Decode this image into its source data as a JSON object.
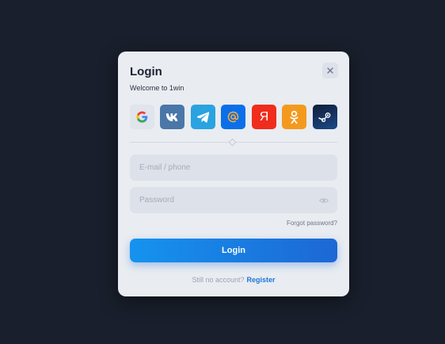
{
  "modal": {
    "title": "Login",
    "subtitle": "Welcome to 1win"
  },
  "social_buttons": [
    {
      "name": "google",
      "icon": "google-icon",
      "bg": "#e0e4ec"
    },
    {
      "name": "vk",
      "icon": "vk-icon",
      "bg": "#4a76a8"
    },
    {
      "name": "telegram",
      "icon": "telegram-icon",
      "bg": "#2aa3e0"
    },
    {
      "name": "mail",
      "icon": "at-icon",
      "bg": "#0b6fe9"
    },
    {
      "name": "yandex",
      "icon": "yandex-icon",
      "bg": "#f02c1c",
      "glyph": "Я"
    },
    {
      "name": "odnoklassniki",
      "icon": "ok-icon",
      "bg": "#f39a1e"
    },
    {
      "name": "steam",
      "icon": "steam-icon",
      "bg": "#1b2a4a"
    }
  ],
  "form": {
    "email_placeholder": "E-mail / phone",
    "email_value": "",
    "password_placeholder": "Password",
    "password_value": "",
    "forgot_label": "Forgot password?",
    "submit_label": "Login"
  },
  "footer": {
    "prompt": "Still no account?",
    "register_label": "Register"
  },
  "colors": {
    "page_background": "#191f2c",
    "modal_background": "#e9ecf1",
    "accent_blue": "#1d76d6"
  }
}
